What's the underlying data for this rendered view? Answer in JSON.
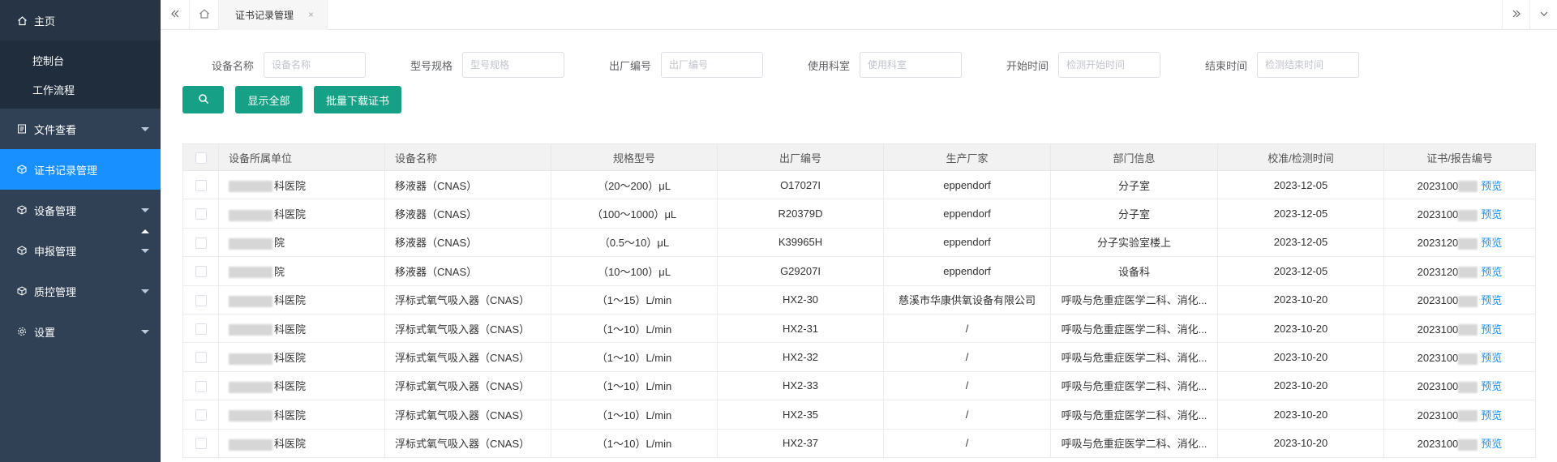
{
  "sidebar": {
    "home": "主页",
    "home_sub": [
      "控制台",
      "工作流程"
    ],
    "items": [
      {
        "label": "文件查看",
        "icon": "file-icon",
        "active": false
      },
      {
        "label": "证书记录管理",
        "icon": "cube-icon",
        "active": true
      },
      {
        "label": "设备管理",
        "icon": "cube-icon",
        "active": false
      },
      {
        "label": "申报管理",
        "icon": "cube-icon",
        "active": false
      },
      {
        "label": "质控管理",
        "icon": "cube-icon",
        "active": false
      },
      {
        "label": "设置",
        "icon": "gear-icon",
        "active": false
      }
    ]
  },
  "tabs": {
    "current": "证书记录管理",
    "close": "×"
  },
  "filters": {
    "device_name": {
      "label": "设备名称",
      "placeholder": "设备名称"
    },
    "model": {
      "label": "型号规格",
      "placeholder": "型号规格"
    },
    "serial": {
      "label": "出厂编号",
      "placeholder": "出厂编号"
    },
    "dept": {
      "label": "使用科室",
      "placeholder": "使用科室"
    },
    "start": {
      "label": "开始时间",
      "placeholder": "检测开始时间"
    },
    "end": {
      "label": "结束时间",
      "placeholder": "检测结束时间"
    }
  },
  "buttons": {
    "show_all": "显示全部",
    "batch_download": "批量下载证书"
  },
  "table": {
    "headers": [
      "设备所属单位",
      "设备名称",
      "规格型号",
      "出厂编号",
      "生产厂家",
      "部门信息",
      "校准/检测时间",
      "证书/报告编号"
    ],
    "preview_label": "预览",
    "rows": [
      {
        "unit": "科医院",
        "name": "移液器（CNAS）",
        "spec": "（20～200）μL",
        "serial": "O17027I",
        "maker": "eppendorf",
        "dept": "分子室",
        "date": "2023-12-05",
        "cert": "2023100"
      },
      {
        "unit": "科医院",
        "name": "移液器（CNAS）",
        "spec": "（100～1000）μL",
        "serial": "R20379D",
        "maker": "eppendorf",
        "dept": "分子室",
        "date": "2023-12-05",
        "cert": "2023100"
      },
      {
        "unit": "院",
        "name": "移液器（CNAS）",
        "spec": "（0.5～10）μL",
        "serial": "K39965H",
        "maker": "eppendorf",
        "dept": "分子实验室楼上",
        "date": "2023-12-05",
        "cert": "2023120"
      },
      {
        "unit": "院",
        "name": "移液器（CNAS）",
        "spec": "（10～100）μL",
        "serial": "G29207I",
        "maker": "eppendorf",
        "dept": "设备科",
        "date": "2023-12-05",
        "cert": "2023120"
      },
      {
        "unit": "科医院",
        "name": "浮标式氧气吸入器（CNAS）",
        "spec": "（1～15）L/min",
        "serial": "HX2-30",
        "maker": "慈溪市华康供氧设备有限公司",
        "dept": "呼吸与危重症医学二科、消化...",
        "date": "2023-10-20",
        "cert": "2023100"
      },
      {
        "unit": "科医院",
        "name": "浮标式氧气吸入器（CNAS）",
        "spec": "（1～10）L/min",
        "serial": "HX2-31",
        "maker": "/",
        "dept": "呼吸与危重症医学二科、消化...",
        "date": "2023-10-20",
        "cert": "2023100"
      },
      {
        "unit": "科医院",
        "name": "浮标式氧气吸入器（CNAS）",
        "spec": "（1～10）L/min",
        "serial": "HX2-32",
        "maker": "/",
        "dept": "呼吸与危重症医学二科、消化...",
        "date": "2023-10-20",
        "cert": "2023100"
      },
      {
        "unit": "科医院",
        "name": "浮标式氧气吸入器（CNAS）",
        "spec": "（1～10）L/min",
        "serial": "HX2-33",
        "maker": "/",
        "dept": "呼吸与危重症医学二科、消化...",
        "date": "2023-10-20",
        "cert": "2023100"
      },
      {
        "unit": "科医院",
        "name": "浮标式氧气吸入器（CNAS）",
        "spec": "（1～10）L/min",
        "serial": "HX2-35",
        "maker": "/",
        "dept": "呼吸与危重症医学二科、消化...",
        "date": "2023-10-20",
        "cert": "2023100"
      },
      {
        "unit": "科医院",
        "name": "浮标式氧气吸入器（CNAS）",
        "spec": "（1～10）L/min",
        "serial": "HX2-37",
        "maker": "/",
        "dept": "呼吸与危重症医学二科、消化...",
        "date": "2023-10-20",
        "cert": "2023100"
      }
    ]
  },
  "colors": {
    "sidebar_bg": "#304156",
    "active_item": "#1890ff",
    "primary_button": "#16a085",
    "link": "#1890ff"
  }
}
